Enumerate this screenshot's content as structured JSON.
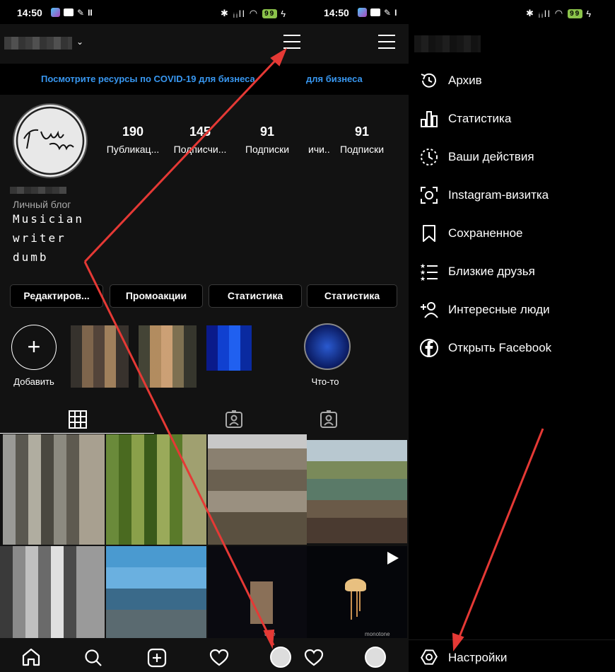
{
  "status": {
    "time": "14:50",
    "battery": "99"
  },
  "profile": {
    "covid_banner": "Посмотрите ресурсы по COVID-19 для бизнеса",
    "covid_banner_cut": "для бизнеса",
    "stats": [
      {
        "value": "190",
        "label": "Публикац..."
      },
      {
        "value": "145",
        "label": "Подписчи..."
      },
      {
        "value": "91",
        "label": "Подписки"
      }
    ],
    "stats_cut": {
      "value": "91",
      "label": "Подписки",
      "left_fragment": "ичи..."
    },
    "category": "Личный блог",
    "bio": [
      "Musician",
      "writer",
      "dumb"
    ],
    "buttons": [
      "Редактиров...",
      "Промоакции",
      "Статистика",
      "Статистика"
    ],
    "highlights": {
      "add_label": "Добавить",
      "last_label": "Что-то"
    },
    "overlay_text": [
      "tone",
      "monotone"
    ]
  },
  "menu": {
    "items": [
      {
        "label": "Архив",
        "icon": "archive-icon"
      },
      {
        "label": "Статистика",
        "icon": "statistics-icon"
      },
      {
        "label": "Ваши действия",
        "icon": "activity-icon"
      },
      {
        "label": "Instagram-визитка",
        "icon": "nametag-icon"
      },
      {
        "label": "Сохраненное",
        "icon": "bookmark-icon"
      },
      {
        "label": "Близкие друзья",
        "icon": "close-friends-icon"
      },
      {
        "label": "Интересные люди",
        "icon": "discover-people-icon"
      },
      {
        "label": "Открыть Facebook",
        "icon": "facebook-icon"
      }
    ],
    "settings_label": "Настройки"
  },
  "colors": {
    "banner": "#3897f0",
    "arrow": "#e53935",
    "panel_bg": "#121212"
  }
}
